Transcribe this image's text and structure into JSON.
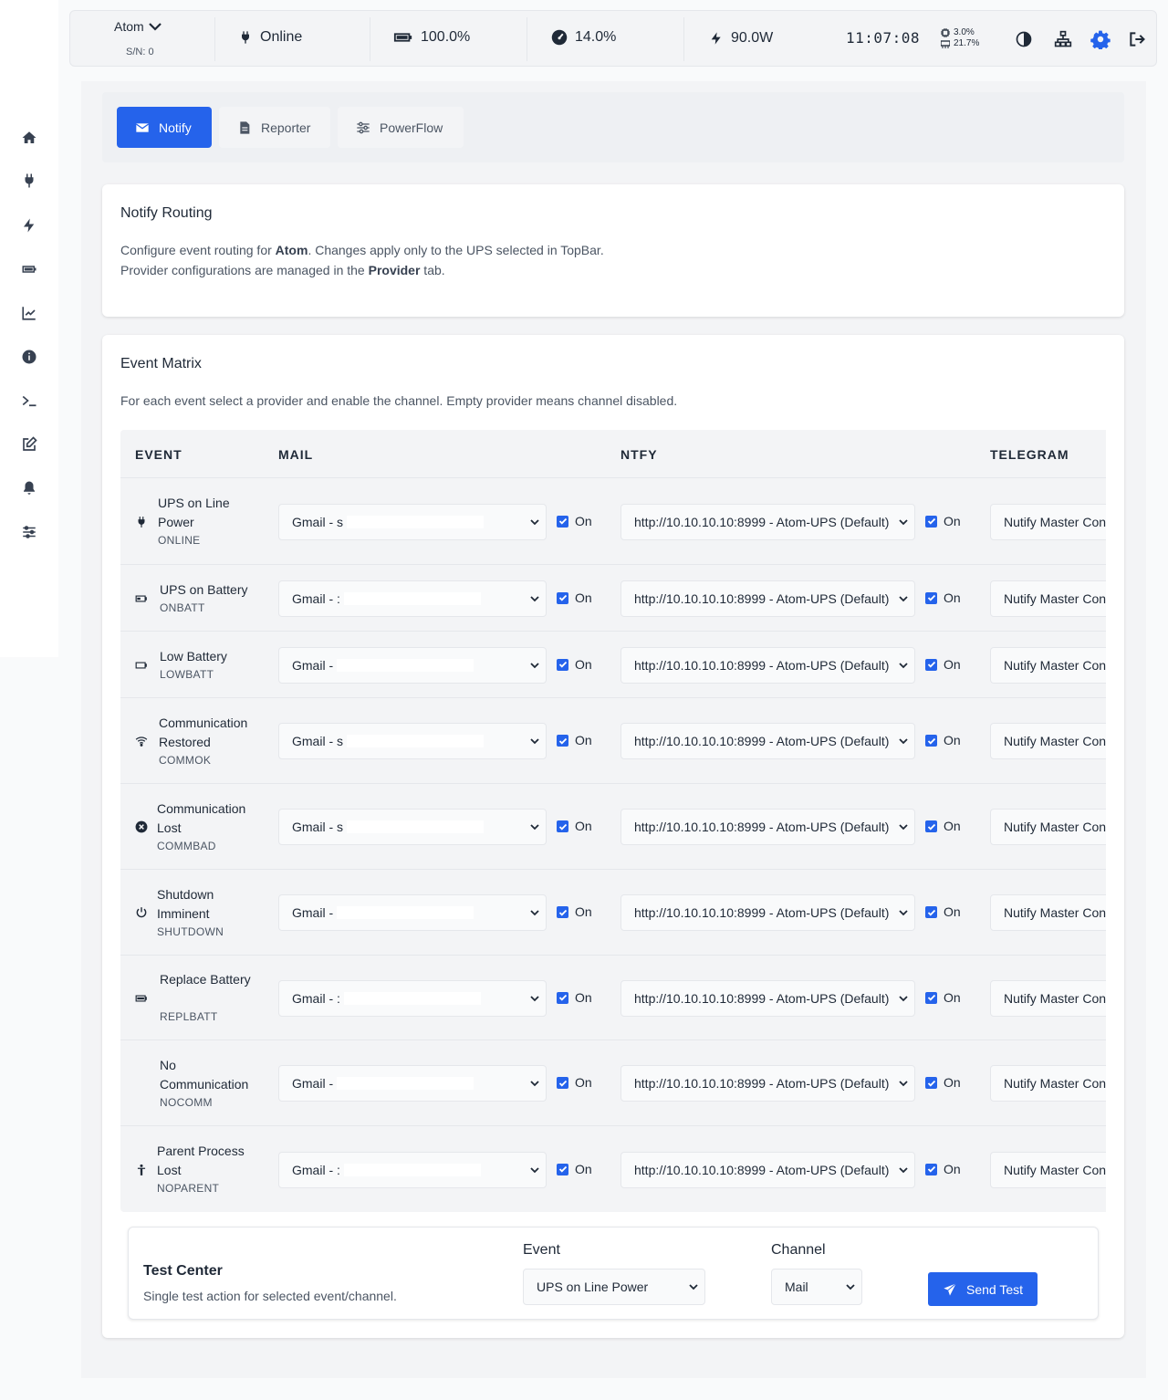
{
  "topbar": {
    "ups_name": "Atom",
    "serial": "S/N: 0",
    "status": "Online",
    "battery": "100.0%",
    "load": "14.0%",
    "power": "90.0W",
    "clock": "11:07:08",
    "cpu": "3.0%",
    "mem": "21.7%"
  },
  "sidebar": {
    "items": [
      "home-icon",
      "plug-icon",
      "bolt-icon",
      "battery-icon",
      "chart-line-icon",
      "info-icon",
      "terminal-icon",
      "edit-icon",
      "bell-icon",
      "sliders-icon"
    ]
  },
  "tabs": [
    {
      "label": "Notify",
      "icon": "envelope-icon",
      "active": true
    },
    {
      "label": "Reporter",
      "icon": "file-icon",
      "active": false
    },
    {
      "label": "PowerFlow",
      "icon": "sliders-icon",
      "active": false
    }
  ],
  "routing": {
    "title": "Notify Routing",
    "line1_pre": "Configure event routing for ",
    "line1_bold": "Atom",
    "line1_post": ". Changes apply only to the UPS selected in TopBar.",
    "line2_pre": "Provider configurations are managed in the ",
    "line2_bold": "Provider",
    "line2_post": " tab."
  },
  "matrix": {
    "title": "Event Matrix",
    "description": "For each event select a provider and enable the channel. Empty provider means channel disabled.",
    "headers": {
      "event": "EVENT",
      "mail": "MAIL",
      "ntfy": "NTFY",
      "telegram": "TELEGRAM"
    },
    "on_label": "On",
    "rows": [
      {
        "name": "UPS on Line Power",
        "code": "ONLINE",
        "icon": "plug-icon",
        "mail": "Gmail - s",
        "ntfy": "http://10.10.10.10:8999 - Atom-UPS (Default)",
        "telegram": "Nutify Master Con"
      },
      {
        "name": "UPS on Battery",
        "code": "ONBATT",
        "icon": "battery-half-icon",
        "mail": "Gmail - :",
        "ntfy": "http://10.10.10.10:8999 - Atom-UPS (Default)",
        "telegram": "Nutify Master Con"
      },
      {
        "name": "Low Battery",
        "code": "LOWBATT",
        "icon": "battery-empty-icon",
        "mail": "Gmail -",
        "ntfy": "http://10.10.10.10:8999 - Atom-UPS (Default)",
        "telegram": "Nutify Master Con"
      },
      {
        "name": "Communication Restored",
        "code": "COMMOK",
        "icon": "wifi-icon",
        "mail": "Gmail - s",
        "ntfy": "http://10.10.10.10:8999 - Atom-UPS (Default)",
        "telegram": "Nutify Master Con"
      },
      {
        "name": "Communication Lost",
        "code": "COMMBAD",
        "icon": "circle-x-icon",
        "mail": "Gmail - s",
        "ntfy": "http://10.10.10.10:8999 - Atom-UPS (Default)",
        "telegram": "Nutify Master Con"
      },
      {
        "name": "Shutdown Imminent",
        "code": "SHUTDOWN",
        "icon": "power-icon",
        "mail": "Gmail -",
        "ntfy": "http://10.10.10.10:8999 - Atom-UPS (Default)",
        "telegram": "Nutify Master Con"
      },
      {
        "name": "Replace Battery",
        "code": "REPLBATT",
        "icon": "battery-full-icon",
        "mail": "Gmail - :",
        "ntfy": "http://10.10.10.10:8999 - Atom-UPS (Default)",
        "telegram": "Nutify Master Con"
      },
      {
        "name": "No Communication",
        "code": "NOCOMM",
        "icon": "",
        "mail": "Gmail -",
        "ntfy": "http://10.10.10.10:8999 - Atom-UPS (Default)",
        "telegram": "Nutify Master Con"
      },
      {
        "name": "Parent Process Lost",
        "code": "NOPARENT",
        "icon": "child-icon",
        "mail": "Gmail - :",
        "ntfy": "http://10.10.10.10:8999 - Atom-UPS (Default)",
        "telegram": "Nutify Master Con"
      }
    ]
  },
  "test_center": {
    "title": "Test Center",
    "subtitle": "Single test action for selected event/channel.",
    "event_label": "Event",
    "event_value": "UPS on Line Power",
    "channel_label": "Channel",
    "channel_value": "Mail",
    "send_label": "Send Test"
  },
  "colors": {
    "accent": "#2563eb",
    "text": "#1f2937",
    "muted": "#4b5563"
  }
}
